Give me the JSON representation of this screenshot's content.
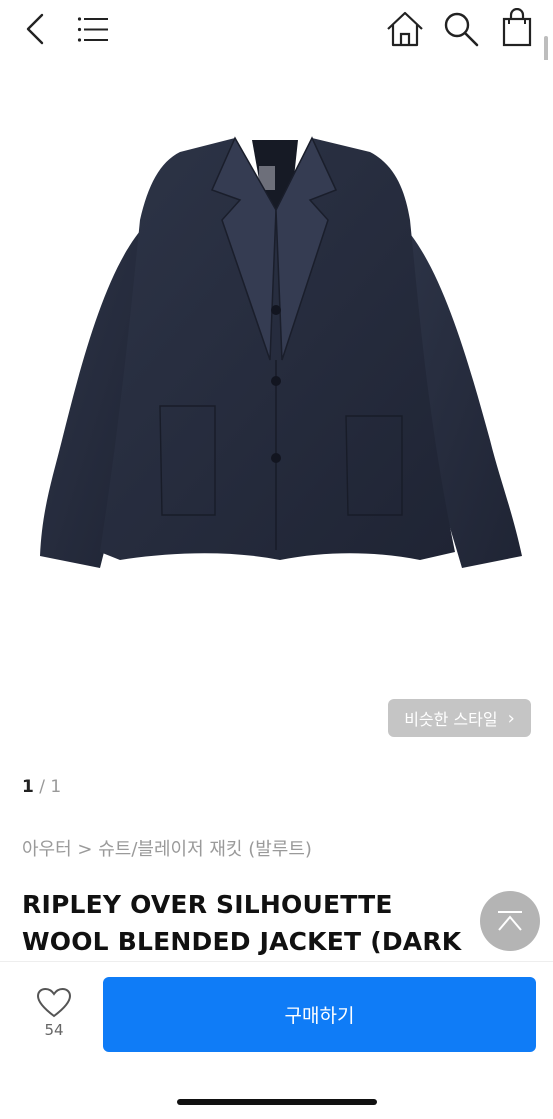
{
  "nav": {
    "back_icon": "chevron-left-icon",
    "menu_icon": "hamburger-menu-icon",
    "home_icon": "home-icon",
    "search_icon": "search-icon",
    "cart_icon": "shopping-bag-icon"
  },
  "gallery": {
    "similar_style_label": "비슷한 스타일",
    "current_page": "1",
    "separator": " / ",
    "total_pages": "1"
  },
  "breadcrumb": "아우터 > 슈트/블레이저 재킷 (발루트)",
  "product": {
    "title": "RIPLEY OVER SILHOUETTE WOOL BLENDED JACKET (DARK NAVY)"
  },
  "bottom_bar": {
    "like_count": "54",
    "buy_label": "구매하기"
  },
  "colors": {
    "accent": "#0f7cf7",
    "jacket": "#262c3d"
  }
}
